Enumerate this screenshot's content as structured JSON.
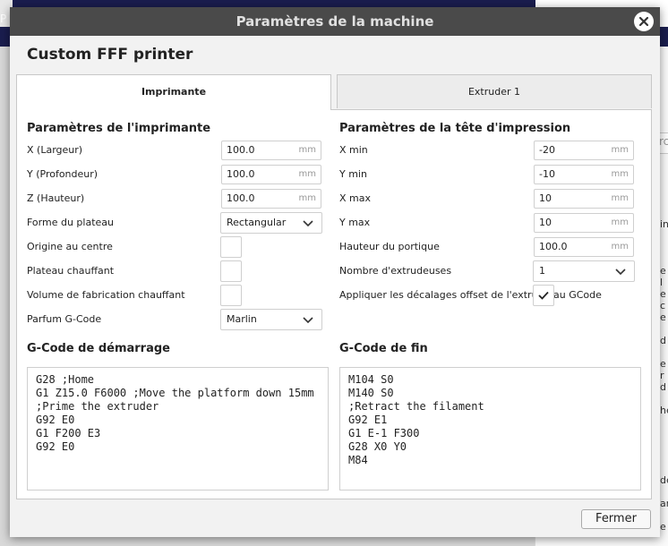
{
  "background": {
    "left_fragment": "P",
    "search_placeholder": "rc",
    "side_letters": [
      "in",
      "e l",
      "e c",
      "e",
      "d",
      "e r",
      "d",
      "he",
      "de",
      "ar",
      "e"
    ]
  },
  "dialog": {
    "title": "Paramètres de la machine",
    "printer_name": "Custom FFF printer",
    "tabs": [
      {
        "label": "Imprimante",
        "active": true
      },
      {
        "label": "Extruder 1",
        "active": false
      }
    ],
    "close_label": "Fermer"
  },
  "printer_settings": {
    "heading": "Paramètres de l'imprimante",
    "x_label": "X (Largeur)",
    "x_value": "100.0",
    "x_unit": "mm",
    "y_label": "Y (Profondeur)",
    "y_value": "100.0",
    "y_unit": "mm",
    "z_label": "Z (Hauteur)",
    "z_value": "100.0",
    "z_unit": "mm",
    "bed_shape_label": "Forme du plateau",
    "bed_shape_value": "Rectangular",
    "origin_center_label": "Origine au centre",
    "origin_center_checked": false,
    "heated_bed_label": "Plateau chauffant",
    "heated_bed_checked": false,
    "heated_volume_label": "Volume de fabrication chauffant",
    "heated_volume_checked": false,
    "gcode_flavor_label": "Parfum G-Code",
    "gcode_flavor_value": "Marlin"
  },
  "head_settings": {
    "heading": "Paramètres de la tête d'impression",
    "xmin_label": "X min",
    "xmin_value": "-20",
    "xmin_unit": "mm",
    "ymin_label": "Y min",
    "ymin_value": "-10",
    "ymin_unit": "mm",
    "xmax_label": "X max",
    "xmax_value": "10",
    "xmax_unit": "mm",
    "ymax_label": "Y max",
    "ymax_value": "10",
    "ymax_unit": "mm",
    "gantry_label": "Hauteur du portique",
    "gantry_value": "100.0",
    "gantry_unit": "mm",
    "extruders_label": "Nombre d'extrudeuses",
    "extruders_value": "1",
    "offset_label_a": "Appliquer les décalages offset de l'extrude",
    "offset_label_b": "au GCode",
    "offset_checked": true
  },
  "start_gcode": {
    "heading": "G-Code de démarrage",
    "lines": [
      "G28 ;Home",
      "G1 Z15.0 F6000 ;Move the platform down 15mm",
      ";Prime the extruder",
      "G92 E0",
      "G1 F200 E3",
      "G92 E0"
    ]
  },
  "end_gcode": {
    "heading": "G-Code de fin",
    "lines": [
      "M104 S0",
      "M140 S0",
      ";Retract the filament",
      "G92 E1",
      "G1 E-1 F300",
      "G28 X0 Y0",
      "M84"
    ]
  },
  "colors": {
    "titlebar": "#4a4a4a",
    "app_header": "#1a1d4e",
    "dialog_bg": "#f2f2f2"
  }
}
